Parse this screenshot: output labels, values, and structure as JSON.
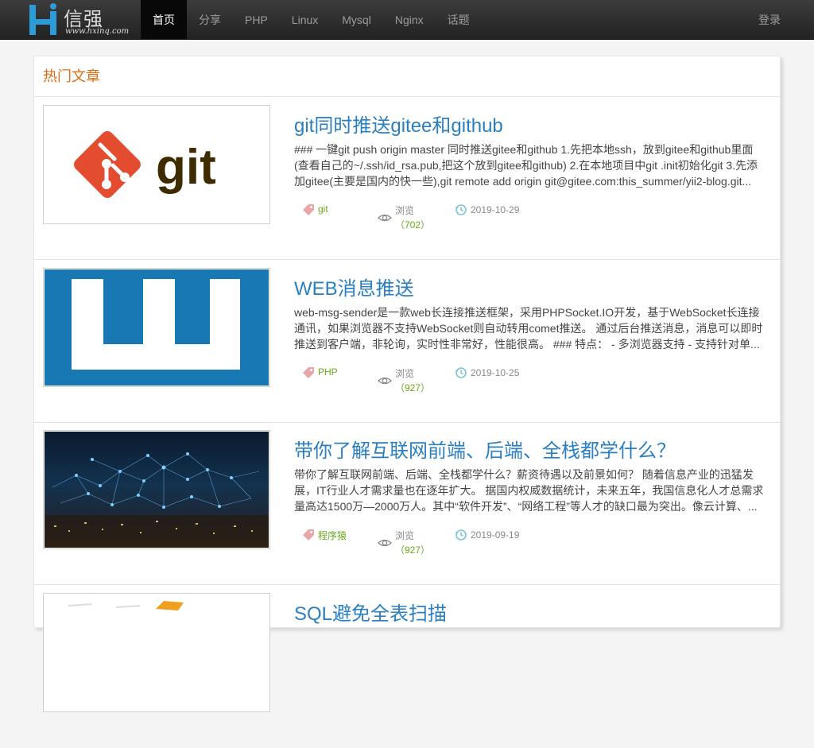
{
  "header": {
    "logo_cn": "信强",
    "logo_url": "www.hxinq.com",
    "nav": [
      "首页",
      "分享",
      "PHP",
      "Linux",
      "Mysql",
      "Nginx",
      "话题"
    ],
    "login": "登录"
  },
  "panel": {
    "heading": "热门文章",
    "colors": {
      "heading": "#e06b12",
      "title": "#2a7fc1",
      "accent": "#6aa91a"
    }
  },
  "articles": [
    {
      "title": "git同时推送gitee和github",
      "description": "### 一键git push origin master 同时推送gitee和github 1.先把本地ssh，放到gitee和github里面(查看自己的~/.ssh/id_rsa.pub,把这个放到gitee和github) 2.在本地项目中git .init初始化git 3.先添加gitee(主要是国内的快一些),git remote add origin git@gitee.com:this_summer/yii2-blog.git...",
      "tag": "git",
      "views_label": "浏览",
      "views": "（702）",
      "date": "2019-10-29",
      "thumb_text": "git"
    },
    {
      "title": "WEB消息推送",
      "description": "web-msg-sender是一款web长连接推送框架，采用PHPSocket.IO开发，基于WebSocket长连接通讯，如果浏览器不支持WebSocket则自动转用comet推送。 通过后台推送消息，消息可以即时推送到客户端，非轮询，实时性非常好，性能很高。 ### 特点： - 多浏览器支持 - 支持针对单...",
      "tag": "PHP",
      "views_label": "浏览",
      "views": "（927）",
      "date": "2019-10-25",
      "thumb_text": ""
    },
    {
      "title": "带你了解互联网前端、后端、全栈都学什么？",
      "description": "带你了解互联网前端、后端、全栈都学什么？薪资待遇以及前景如何？ 随着信息产业的迅猛发展，IT行业人才需求量也在逐年扩大。 据国内权威数据统计，未来五年，我国信息化人才总需求量高达1500万—2000万人。其中“软件开发”、“网络工程”等人才的缺口最为突出。像云计算、...",
      "tag": "程序猿",
      "views_label": "浏览",
      "views": "（927）",
      "date": "2019-09-19",
      "thumb_text": ""
    },
    {
      "title": "SQL避免全表扫描",
      "description": "",
      "tag": "",
      "views_label": "",
      "views": "",
      "date": "",
      "thumb_text": ""
    }
  ]
}
